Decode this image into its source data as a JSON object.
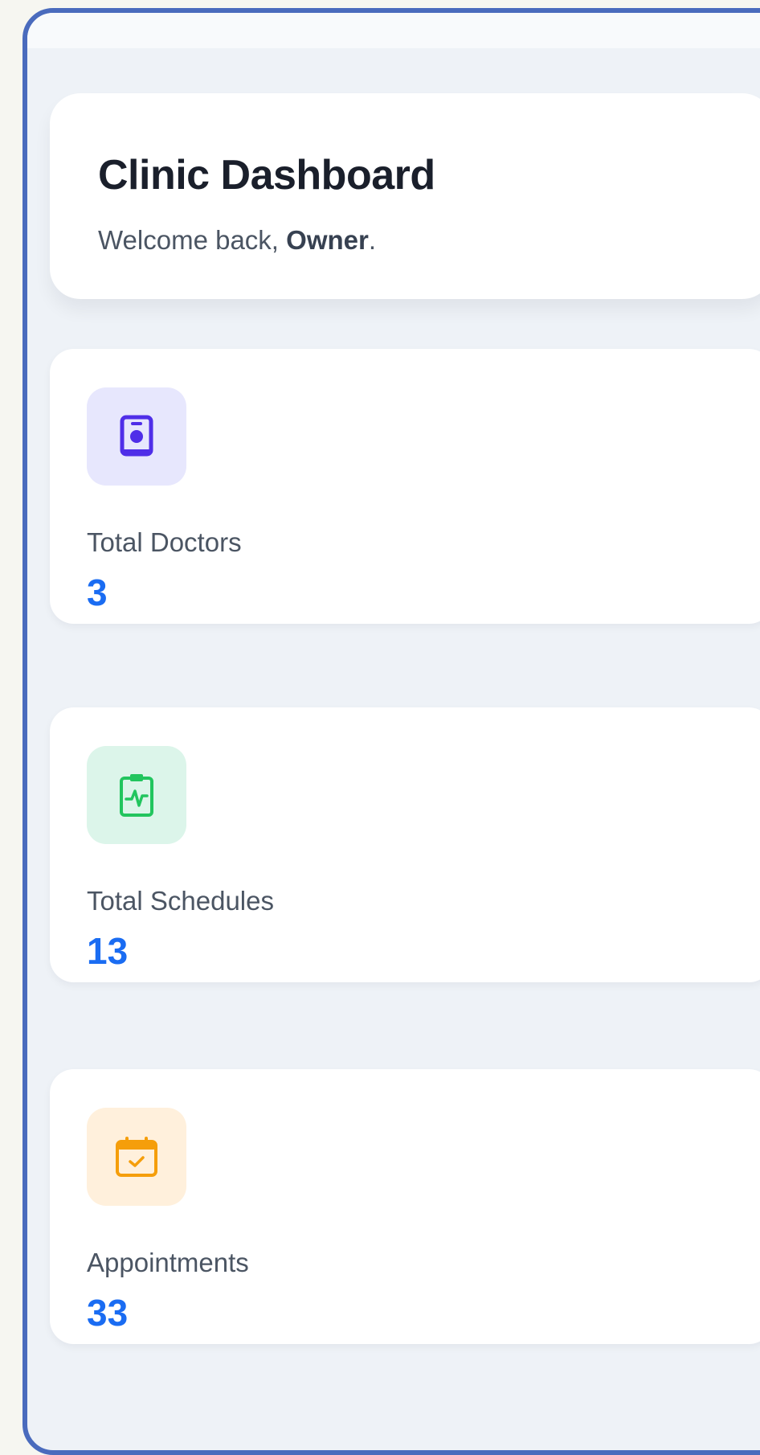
{
  "header": {
    "title": "Clinic Dashboard",
    "welcome_prefix": "Welcome back, ",
    "welcome_user": "Owner",
    "welcome_suffix": "."
  },
  "stats": [
    {
      "label": "Total Doctors",
      "value": "3",
      "icon": "id-badge-icon",
      "icon_color": "#4f2ee8",
      "icon_bg": "#e7e7fd"
    },
    {
      "label": "Total Schedules",
      "value": "13",
      "icon": "clipboard-pulse-icon",
      "icon_color": "#22c55e",
      "icon_bg": "#dcf5ea"
    },
    {
      "label": "Appointments",
      "value": "33",
      "icon": "calendar-check-icon",
      "icon_color": "#f59e0b",
      "icon_bg": "#fff0dc"
    }
  ],
  "colors": {
    "accent": "#1a6cf2",
    "frame_border": "#4a6bbd",
    "page_background": "#eef2f7"
  }
}
